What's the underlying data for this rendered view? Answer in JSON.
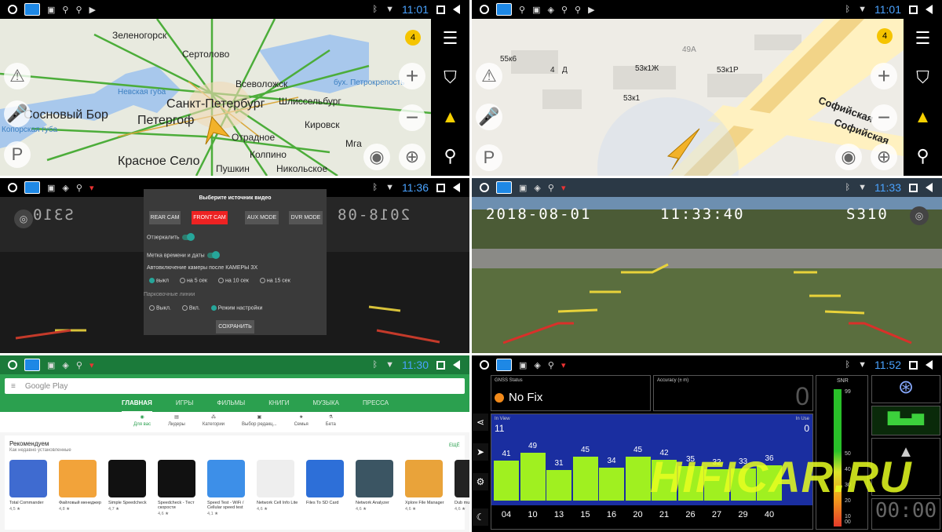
{
  "status_bars": {
    "tl": {
      "time": "11:01"
    },
    "tr": {
      "time": "11:01"
    },
    "ml": {
      "time": "11:36"
    },
    "mr": {
      "time": "11:33"
    },
    "bl": {
      "time": "11:30"
    },
    "br": {
      "time": "11:52"
    }
  },
  "map1": {
    "badge": "4",
    "labels": [
      "Зеленогорск",
      "Сертолово",
      "Всеволожск",
      "Санкт-Петербург",
      "Шлиссельбург",
      "Петергоф",
      "Сосновый Бор",
      "Кировск",
      "Красное Село",
      "Пушкин",
      "Колпино",
      "Никольское",
      "Мга",
      "Невская губа",
      "бух. Петрокрепость",
      "Копорская губа",
      "Отрадное"
    ]
  },
  "map2": {
    "badge": "4",
    "labels": [
      "55к6",
      "53к1Ж",
      "53к1Р",
      "53к1",
      "49А",
      "4",
      "Д",
      "Софийская",
      "Софийская"
    ]
  },
  "camera": {
    "dialog_title": "Выберите источник видео",
    "buttons": [
      "REAR CAM",
      "FRONT CAM",
      "AUX MODE",
      "DVR MODE"
    ],
    "mirror_label": "Отзеркалить",
    "timestamp_label": "Метка времени и даты",
    "auto_label": "Автовключение камеры после КАМЕРЫ ЗХ",
    "auto_options": [
      "выкл",
      "на 5 сек",
      "на 10 сек",
      "на 15 сек"
    ],
    "parking_label": "Парковочные линии",
    "parking_options": [
      "Выкл.",
      "Вкл.",
      "Режим настройки"
    ],
    "save_label": "СОХРАНИТЬ",
    "osd_date": "2018-08-01",
    "osd_time": "11:33:40",
    "osd_model": "S310",
    "mirrored_date": "2018-08",
    "mirrored_model": "S310"
  },
  "play": {
    "search_placeholder": "Google Play",
    "tabs": [
      "ГЛАВНАЯ",
      "ИГРЫ",
      "ФИЛЬМЫ",
      "КНИГИ",
      "МУЗЫКА",
      "ПРЕССА"
    ],
    "categories": [
      "Для вас",
      "Лидеры",
      "Категории",
      "Выбор редакц...",
      "Семья",
      "Бета"
    ],
    "section_title": "Рекомендуем",
    "section_sub": "Как недавно установленные",
    "section_more": "ЕЩЁ",
    "apps": [
      {
        "name": "Total Commander",
        "rating": "4,5 ★",
        "color": "#3f6bd0"
      },
      {
        "name": "Файловый менеджер",
        "rating": "4,8 ★",
        "color": "#f2a33a"
      },
      {
        "name": "Simple Speedcheck",
        "rating": "4,7 ★",
        "color": "#111111"
      },
      {
        "name": "Speedcheck - Тест скорости",
        "rating": "4,6 ★",
        "color": "#111111"
      },
      {
        "name": "Speed Test - WiFi / Cellular speed test",
        "rating": "4,1 ★",
        "color": "#3d8fe8"
      },
      {
        "name": "Network Cell Info Lite",
        "rating": "4,6 ★",
        "color": "#eeeeee"
      },
      {
        "name": "Files To SD Card",
        "rating": "",
        "color": "#2d6fd8"
      },
      {
        "name": "Network Analyzer",
        "rating": "4,6 ★",
        "color": "#3b5563"
      },
      {
        "name": "Xplore File Manager",
        "rating": "4,6 ★",
        "color": "#e9a33a"
      },
      {
        "name": "Dub mus...",
        "rating": "4,6 ★",
        "color": "#222222"
      }
    ]
  },
  "gnss": {
    "status_title": "GNSS Status",
    "status_value": "No Fix",
    "accuracy_title": "Accuracy (± m)",
    "accuracy_value": "0",
    "in_view_label": "In View",
    "in_view_value": "11",
    "in_use_label": "In Use",
    "in_use_value": "0",
    "snr_label": "SNR",
    "snr_ticks": [
      "99",
      "50",
      "40",
      "30",
      "20",
      "10",
      "00"
    ],
    "clock": "00:00",
    "watermark": "HIFICAR.RU",
    "satellites": [
      {
        "id": "04",
        "snr": 41
      },
      {
        "id": "10",
        "snr": 49
      },
      {
        "id": "13",
        "snr": 31
      },
      {
        "id": "15",
        "snr": 45
      },
      {
        "id": "16",
        "snr": 34
      },
      {
        "id": "20",
        "snr": 45
      },
      {
        "id": "21",
        "snr": 42
      },
      {
        "id": "26",
        "snr": 35
      },
      {
        "id": "27",
        "snr": 32
      },
      {
        "id": "29",
        "snr": 33
      },
      {
        "id": "40",
        "snr": 36
      }
    ]
  }
}
